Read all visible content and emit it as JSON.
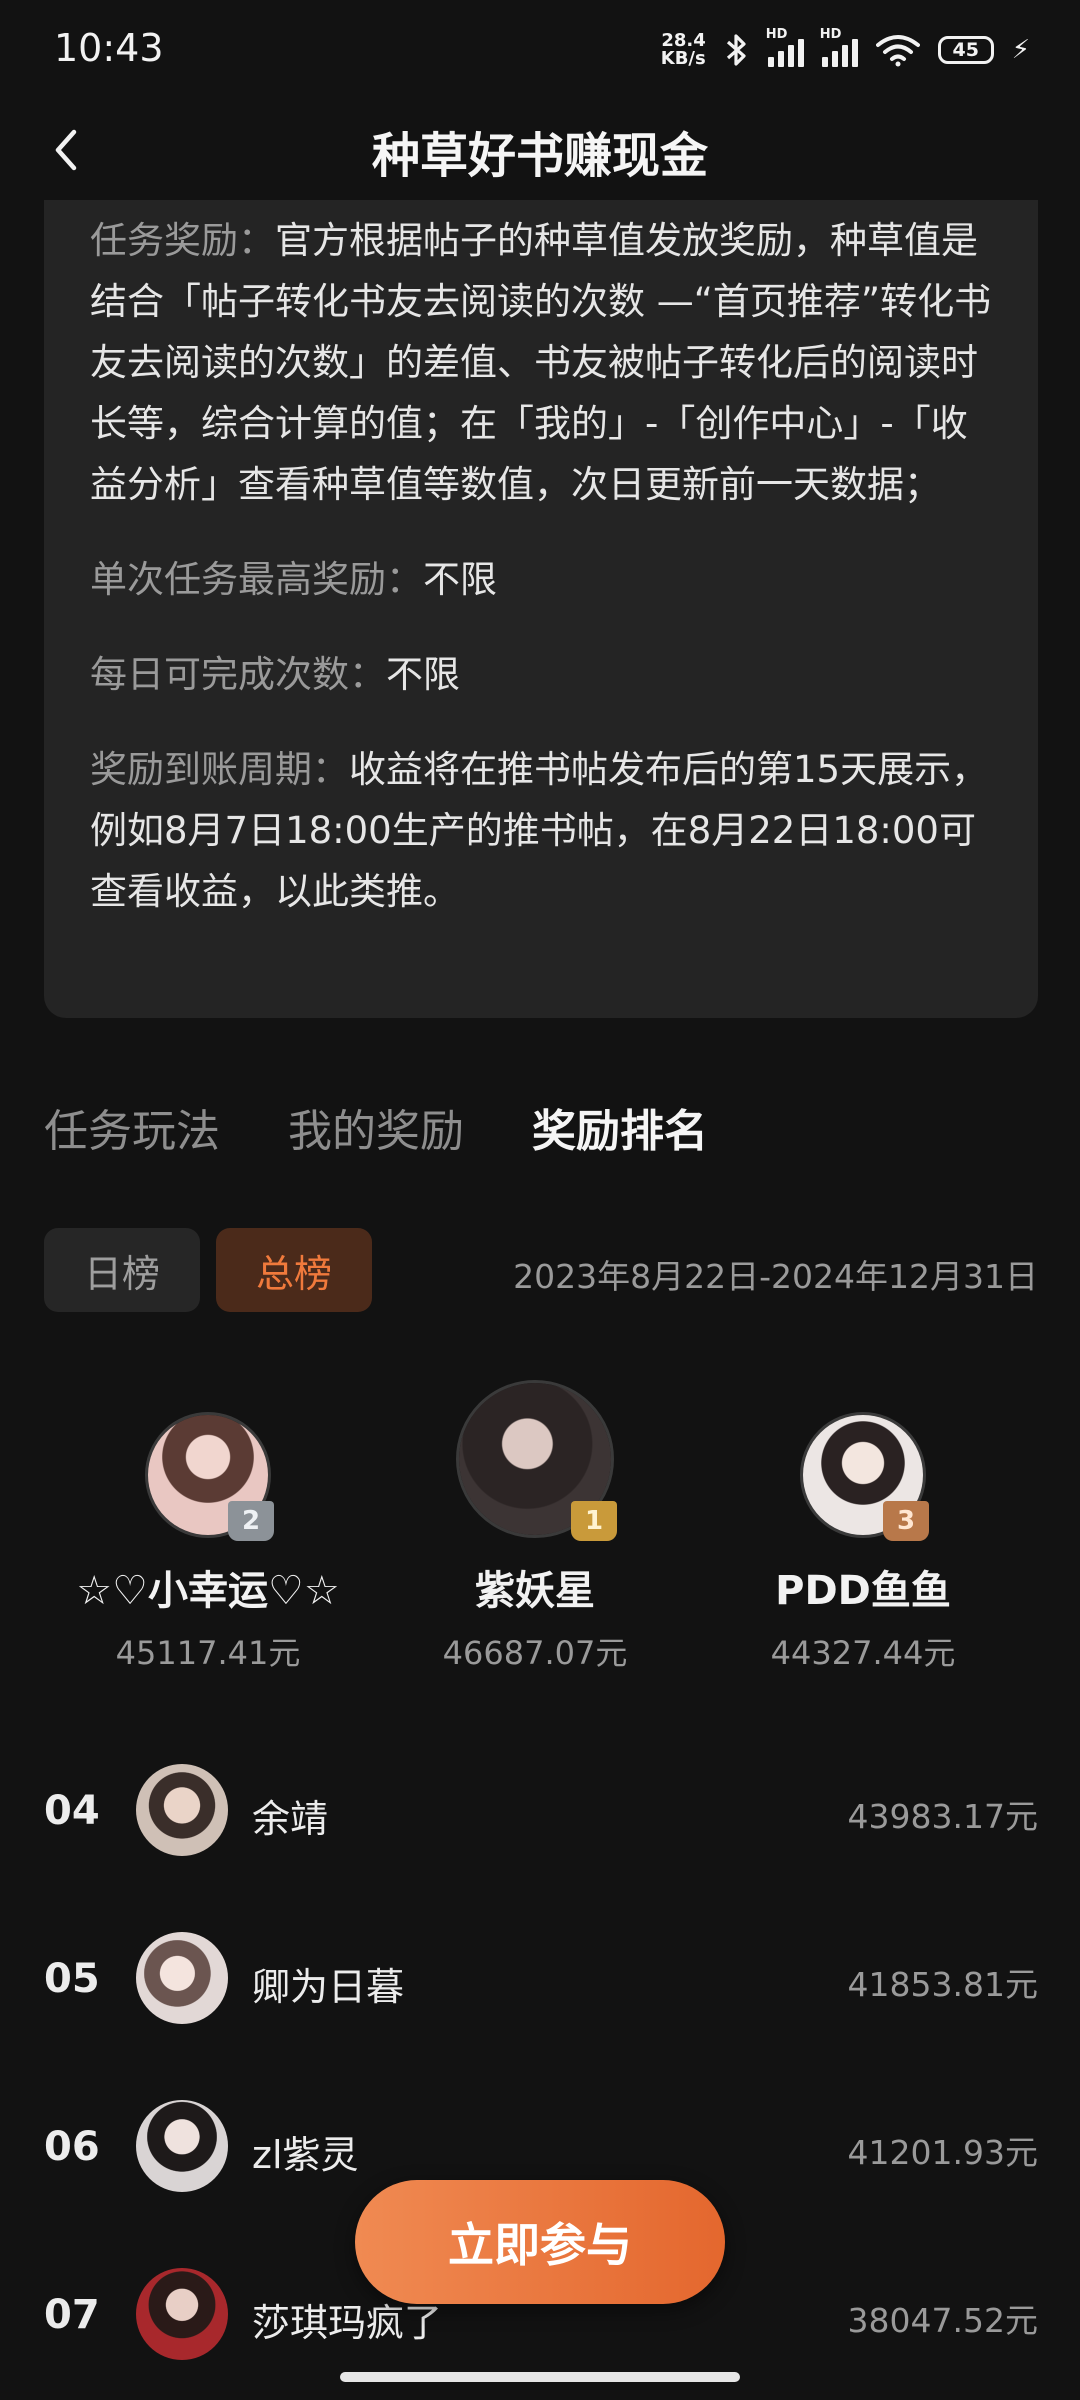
{
  "status_bar": {
    "time": "10:43",
    "net_speed_value": "28.4",
    "net_speed_unit": "KB/s",
    "hd_label": "HD",
    "battery": "45"
  },
  "header": {
    "title": "种草好书赚现金"
  },
  "rules": [
    {
      "label": "任务奖励：",
      "text": "官方根据帖子的种草值发放奖励，种草值是结合「帖子转化书友去阅读的次数 —“首页推荐”转化书友去阅读的次数」的差值、书友被帖子转化后的阅读时长等，综合计算的值；在「我的」-「创作中心」-「收益分析」查看种草值等数值，次日更新前一天数据；"
    },
    {
      "label": "单次任务最高奖励：",
      "text": "不限"
    },
    {
      "label": "每日可完成次数：",
      "text": "不限"
    },
    {
      "label": "奖励到账周期：",
      "text": "收益将在推书帖发布后的第15天展示，例如8月7日18:00生产的推书帖，在8月22日18:00可查看收益，以此类推。"
    }
  ],
  "tabs": [
    "任务玩法",
    "我的奖励",
    "奖励排名"
  ],
  "active_tab": "奖励排名",
  "board": {
    "daily": "日榜",
    "total": "总榜",
    "selected": "总榜",
    "date_range": "2023年8月22日-2024年12月31日"
  },
  "podium": [
    {
      "rank": "2",
      "name": "☆♡小幸运♡☆",
      "amount": "45117.41元"
    },
    {
      "rank": "1",
      "name": "紫妖星",
      "amount": "46687.07元"
    },
    {
      "rank": "3",
      "name": "PDD鱼鱼",
      "amount": "44327.44元"
    }
  ],
  "list": [
    {
      "rank": "04",
      "name": "余靖",
      "amount": "43983.17元"
    },
    {
      "rank": "05",
      "name": "卿为日暮",
      "amount": "41853.81元"
    },
    {
      "rank": "06",
      "name": "zl紫灵",
      "amount": "41201.93元"
    },
    {
      "rank": "07",
      "name": "莎琪玛疯了",
      "amount": "38047.52元"
    }
  ],
  "cta": {
    "label": "立即参与"
  },
  "colors": {
    "accent": "#e8703a",
    "background": "#121212",
    "card": "#242424"
  }
}
